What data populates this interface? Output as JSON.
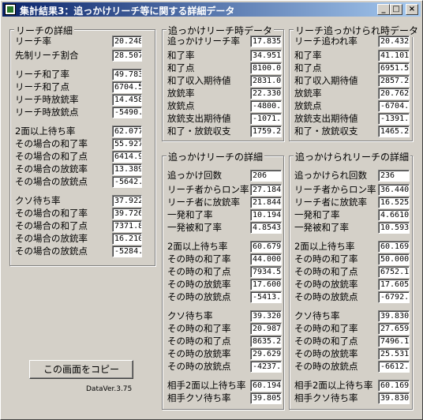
{
  "window": {
    "title": "集計結果3：追っかけリーチ等に関する詳細データ",
    "buttons": [
      "_",
      "□",
      "×"
    ]
  },
  "reach_detail": {
    "title": "リーチの詳細",
    "rows": [
      {
        "label": "リーチ率",
        "value": "20.2489"
      },
      {
        "label": "先制リーチ割合",
        "value": "28.5070"
      },
      {
        "label": "リーチ和了率",
        "value": "49.7835"
      },
      {
        "label": "リーチ和了点",
        "value": "6704.52"
      },
      {
        "label": "リーチ時放銃率",
        "value": "14.4588"
      },
      {
        "label": "リーチ時放銃点",
        "value": "-5490.4"
      },
      {
        "label": "2面以上待ち率",
        "value": "62.0779"
      },
      {
        "label": "その場合の和了率",
        "value": "55.9274"
      },
      {
        "label": "その場合の和了点",
        "value": "6414.96"
      },
      {
        "label": "その場合の放銃率",
        "value": "13.3891"
      },
      {
        "label": "その場合の放銃点",
        "value": "-5642.7"
      },
      {
        "label": "クソ待ち率",
        "value": "37.9220"
      },
      {
        "label": "その場合の和了率",
        "value": "39.7260"
      },
      {
        "label": "その場合の和了点",
        "value": "7371.83"
      },
      {
        "label": "その場合の放銃率",
        "value": "16.2100"
      },
      {
        "label": "その場合の放銃点",
        "value": "-5284.5"
      }
    ]
  },
  "chase_data": {
    "title": "追っかけリーチ時データ",
    "rows": [
      {
        "label": "追っかけリーチ率",
        "value": "17.8354"
      },
      {
        "label": "和了率",
        "value": "34.9514"
      },
      {
        "label": "和了点",
        "value": "8100.00"
      },
      {
        "label": "和了収入期待値",
        "value": "2831.06"
      },
      {
        "label": "放銃率",
        "value": "22.3300"
      },
      {
        "label": "放銃点",
        "value": "-4800.0"
      },
      {
        "label": "放銃支出期待値",
        "value": "-1071.8"
      },
      {
        "label": "和了・放銃収支",
        "value": "1759.22"
      }
    ]
  },
  "chased_data": {
    "title": "リーチ追っかけられ時データ",
    "rows": [
      {
        "label": "リーチ追われ率",
        "value": "20.4329"
      },
      {
        "label": "和了率",
        "value": "41.1016"
      },
      {
        "label": "和了点",
        "value": "6951.54"
      },
      {
        "label": "和了収入期待値",
        "value": "2857.20"
      },
      {
        "label": "放銃率",
        "value": "20.7627"
      },
      {
        "label": "放銃点",
        "value": "-6704.0"
      },
      {
        "label": "放銃支出期待値",
        "value": "-1391.9"
      },
      {
        "label": "和了・放銃収支",
        "value": "1465.25"
      }
    ]
  },
  "chase_detail": {
    "title": "追っかけリーチの詳細",
    "rows": [
      {
        "label": "追っかけ回数",
        "value": "206"
      },
      {
        "label": "リーチ者からロン率",
        "value": "27.1844"
      },
      {
        "label": "リーチ者に放銃率",
        "value": "21.8446"
      },
      {
        "label": "一発和了率",
        "value": "10.1941"
      },
      {
        "label": "一発被和了率",
        "value": "4.85436"
      },
      {
        "label": "2面以上待ち率",
        "value": "60.6796"
      },
      {
        "label": "その時の和了率",
        "value": "44.0000"
      },
      {
        "label": "その時の和了点",
        "value": "7934.54"
      },
      {
        "label": "その時の放銃率",
        "value": "17.6000"
      },
      {
        "label": "その時の放銃点",
        "value": "-5413.6"
      },
      {
        "label": "クソ待ち率",
        "value": "39.3203"
      },
      {
        "label": "その時の和了率",
        "value": "20.9876"
      },
      {
        "label": "その時の和了点",
        "value": "8635.29"
      },
      {
        "label": "その時の放銃率",
        "value": "29.6296"
      },
      {
        "label": "その時の放銃点",
        "value": "-4237.5"
      },
      {
        "label": "相手2面以上待ち率",
        "value": "60.1941"
      },
      {
        "label": "相手クソ待ち率",
        "value": "39.8058"
      }
    ]
  },
  "chased_detail": {
    "title": "追っかけられリーチの詳細",
    "rows": [
      {
        "label": "追っかけられ回数",
        "value": "236"
      },
      {
        "label": "リーチ者からロン率",
        "value": "36.4406"
      },
      {
        "label": "リーチ者に放銃率",
        "value": "16.5254"
      },
      {
        "label": "一発和了率",
        "value": "4.66101"
      },
      {
        "label": "一発被和了率",
        "value": "10.5932"
      },
      {
        "label": "2面以上待ち率",
        "value": "60.1694"
      },
      {
        "label": "その時の和了率",
        "value": "50.0000"
      },
      {
        "label": "その時の和了点",
        "value": "6752.11"
      },
      {
        "label": "その時の放銃率",
        "value": "17.6056"
      },
      {
        "label": "その時の放銃点",
        "value": "-6792.0"
      },
      {
        "label": "クソ待ち率",
        "value": "39.8305"
      },
      {
        "label": "その時の和了率",
        "value": "27.6595"
      },
      {
        "label": "その時の和了点",
        "value": "7496.15"
      },
      {
        "label": "その時の放銃率",
        "value": "25.5319"
      },
      {
        "label": "その時の放銃点",
        "value": "-6612.5"
      },
      {
        "label": "相手2面以上待ち率",
        "value": "60.1694"
      },
      {
        "label": "相手クソ待ち率",
        "value": "39.8305"
      }
    ]
  },
  "copy_button": "この画面をコピー",
  "version": "DataVer.3.75"
}
